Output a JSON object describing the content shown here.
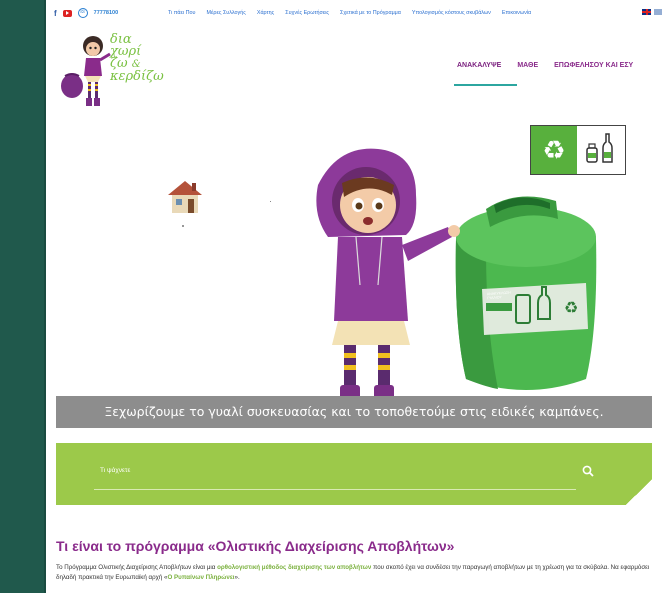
{
  "topbar": {
    "phone": "77778100",
    "links": [
      "Τι πάει Που",
      "Μέρες Συλλογής",
      "Χάρτης",
      "Συχνές Ερωτήσεις",
      "Σχετικά με το Πρόγραμμα",
      "Υπολογισμός κόστους σκυβάλων",
      "Επικοινωνία"
    ]
  },
  "logo": {
    "line1": "δια",
    "line2": "χωρί",
    "line3": "ζω",
    "amp": "&",
    "line4": "κερδίζω"
  },
  "mainnav": [
    "ΑΝΑΚΑΛΥΨΕ",
    "ΜΑΘΕ",
    "ΕΠΩΦΕΛΗΣΟΥ ΚΑΙ ΕΣΥ"
  ],
  "hero": {
    "bin_label": "ΑΝΑΚΥΚΛΩΣΗ ΓΥΑΛΙΟΥ",
    "caption": "Ξεχωρίζουμε το γυαλί συσκευασίας και το τοποθετούμε στις ειδικές καμπάνες."
  },
  "search": {
    "placeholder": "Τι ψάχνετε"
  },
  "content": {
    "title": "Τι είναι το πρόγραμμα «Ολιστικής Διαχείρισης Αποβλήτων»",
    "p_part1": "Το Πρόγραμμα Ολιστικής Διαχείρισης Αποβλήτων είναι μια ",
    "p_highlight1": "ορθολογιστική μέθοδος διαχείρισης των αποβλήτων",
    "p_part2": " που σκοπό έχει να συνδέσει την παραγωγή αποβλήτων με τη χρέωση για τα σκύβαλα. Να εφαρμόσει δηλαδή πρακτικά την Ευρωπαϊκή αρχή «",
    "p_highlight2": "Ο Ρυπαίνων Πληρώνει",
    "p_part3": "»."
  },
  "colors": {
    "brand_purple": "#8a2b8b",
    "brand_green": "#9cc94a",
    "link_blue": "#2a6fd0"
  }
}
